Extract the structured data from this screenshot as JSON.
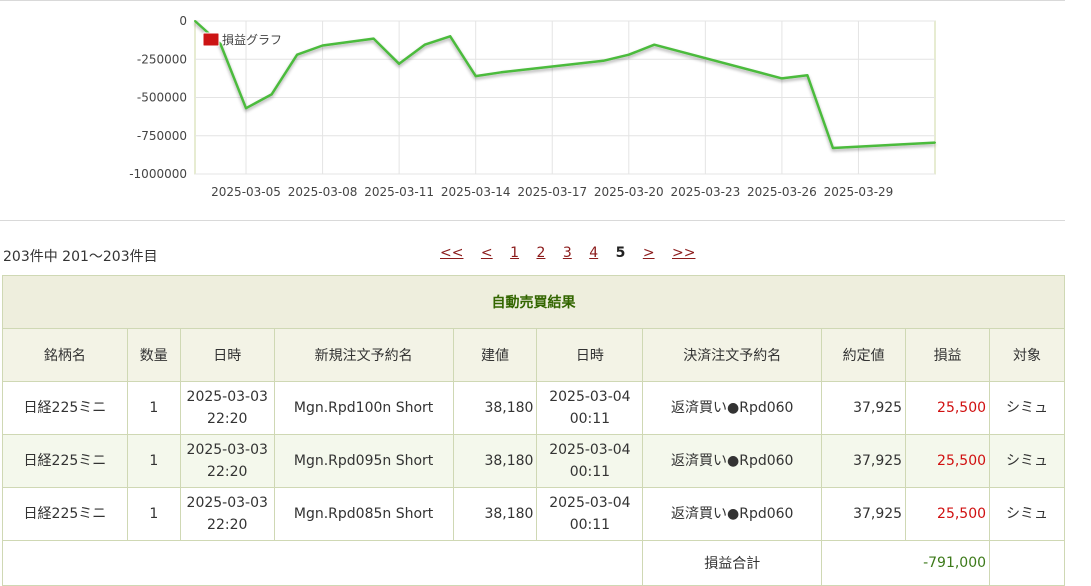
{
  "chart_data": {
    "type": "line",
    "legend": "損益グラフ",
    "legend_position": "top-left",
    "series_color": "#4cbb3c",
    "legend_color": "#cc1414",
    "grid": true,
    "ylim": [
      -1000000,
      0
    ],
    "y_ticks": [
      0,
      -250000,
      -500000,
      -750000,
      -1000000
    ],
    "y_tick_labels": [
      "0",
      "-250000",
      "-500000",
      "-750000",
      "-1000000"
    ],
    "x_tick_labels": [
      "2025-03-05",
      "2025-03-08",
      "2025-03-11",
      "2025-03-14",
      "2025-03-17",
      "2025-03-20",
      "2025-03-23",
      "2025-03-26",
      "2025-03-29"
    ],
    "x": [
      "2025-03-03",
      "2025-03-04",
      "2025-03-05",
      "2025-03-06",
      "2025-03-07",
      "2025-03-08",
      "2025-03-10",
      "2025-03-11",
      "2025-03-12",
      "2025-03-13",
      "2025-03-14",
      "2025-03-15",
      "2025-03-19",
      "2025-03-20",
      "2025-03-21",
      "2025-03-26",
      "2025-03-27",
      "2025-03-28",
      "2025-04-01"
    ],
    "values": [
      0,
      -150000,
      -570000,
      -480000,
      -220000,
      -160000,
      -115000,
      -280000,
      -155000,
      -100000,
      -360000,
      -335000,
      -260000,
      -220000,
      -155000,
      -375000,
      -355000,
      -830000,
      -795000
    ]
  },
  "summary": {
    "count_text": "203件中 201～203件目"
  },
  "pager": {
    "first": "<<",
    "prev": "<",
    "pages": [
      "1",
      "2",
      "3",
      "4"
    ],
    "current": "5",
    "next": ">",
    "last": ">>"
  },
  "table": {
    "caption": "自動売買結果",
    "headers": [
      "銘柄名",
      "数量",
      "日時",
      "新規注文予約名",
      "建値",
      "日時",
      "決済注文予約名",
      "約定値",
      "損益",
      "対象"
    ],
    "rows": [
      {
        "symbol": "日経225ミニ",
        "qty": "1",
        "open_date": "2025-03-03",
        "open_time": "22:20",
        "open_order": "Mgn.Rpd100n Short",
        "entry": "38,180",
        "close_date": "2025-03-04",
        "close_time": "00:11",
        "close_order": "返済買い●Rpd060",
        "exec": "37,925",
        "pl": "25,500",
        "target": "シミュ"
      },
      {
        "symbol": "日経225ミニ",
        "qty": "1",
        "open_date": "2025-03-03",
        "open_time": "22:20",
        "open_order": "Mgn.Rpd095n Short",
        "entry": "38,180",
        "close_date": "2025-03-04",
        "close_time": "00:11",
        "close_order": "返済買い●Rpd060",
        "exec": "37,925",
        "pl": "25,500",
        "target": "シミュ"
      },
      {
        "symbol": "日経225ミニ",
        "qty": "1",
        "open_date": "2025-03-03",
        "open_time": "22:20",
        "open_order": "Mgn.Rpd085n Short",
        "entry": "38,180",
        "close_date": "2025-03-04",
        "close_time": "00:11",
        "close_order": "返済買い●Rpd060",
        "exec": "37,925",
        "pl": "25,500",
        "target": "シミュ"
      }
    ],
    "total_label": "損益合計",
    "total_value": "-791,000"
  }
}
